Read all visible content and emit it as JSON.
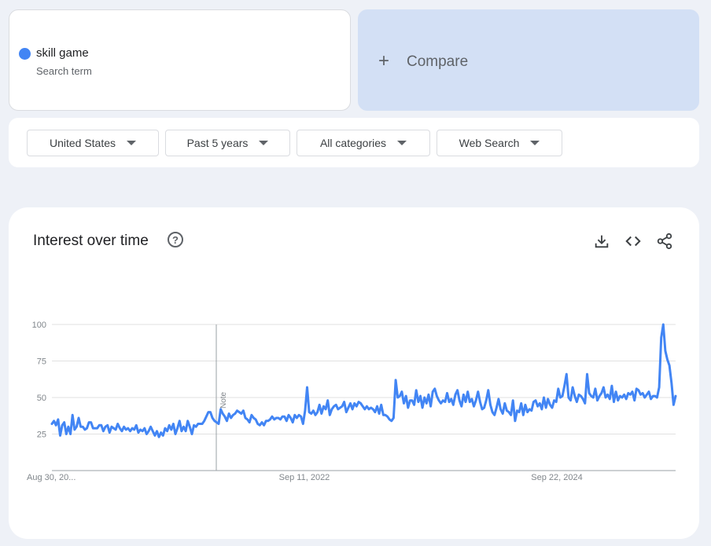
{
  "search_term": {
    "name": "skill game",
    "subtitle": "Search term",
    "color": "#4285f4"
  },
  "compare": {
    "plus": "+",
    "label": "Compare"
  },
  "filters": [
    {
      "label": "United States"
    },
    {
      "label": "Past 5 years"
    },
    {
      "label": "All categories"
    },
    {
      "label": "Web Search"
    }
  ],
  "chart_card": {
    "title": "Interest over time",
    "help_icon": "help-circle-icon",
    "tools": [
      "download-icon",
      "embed-code-icon",
      "share-icon"
    ],
    "help_glyph": "?",
    "embed_glyph": "<>"
  },
  "chart_data": {
    "type": "line",
    "title": "",
    "xlabel": "",
    "ylabel": "",
    "ylim": [
      0,
      100
    ],
    "grid": true,
    "y_ticks": [
      "25",
      "50",
      "75",
      "100"
    ],
    "x_ticks": [
      "Aug 30, 20...",
      "Sep 11, 2022",
      "Sep 22, 2024"
    ],
    "note_label": "Note",
    "series": [
      {
        "color": "#4285f4",
        "values": [
          32,
          34,
          31,
          35,
          24,
          31,
          33,
          25,
          30,
          25,
          38,
          28,
          30,
          36,
          30,
          30,
          28,
          29,
          33,
          33,
          29,
          29,
          29,
          31,
          31,
          27,
          30,
          31,
          26,
          30,
          29,
          28,
          32,
          29,
          27,
          30,
          28,
          29,
          27,
          29,
          28,
          31,
          26,
          28,
          27,
          29,
          25,
          27,
          30,
          27,
          24,
          27,
          23,
          26,
          24,
          29,
          27,
          31,
          28,
          32,
          25,
          29,
          34,
          27,
          30,
          27,
          34,
          30,
          25,
          31,
          30,
          32,
          32,
          32,
          34,
          37,
          40,
          40,
          36,
          34,
          33,
          32,
          42,
          39,
          37,
          34,
          39,
          36,
          38,
          39,
          41,
          40,
          39,
          41,
          36,
          35,
          33,
          38,
          36,
          35,
          32,
          31,
          33,
          31,
          34,
          34,
          35,
          37,
          35,
          36,
          36,
          35,
          37,
          37,
          34,
          38,
          36,
          33,
          38,
          36,
          38,
          37,
          32,
          41,
          57,
          40,
          39,
          41,
          38,
          40,
          45,
          39,
          44,
          42,
          48,
          38,
          42,
          44,
          45,
          42,
          43,
          44,
          47,
          40,
          43,
          46,
          42,
          46,
          44,
          47,
          46,
          44,
          42,
          44,
          42,
          43,
          42,
          40,
          44,
          39,
          45,
          38,
          38,
          37,
          35,
          34,
          36,
          62,
          50,
          51,
          54,
          46,
          51,
          43,
          48,
          48,
          45,
          55,
          47,
          51,
          43,
          50,
          46,
          52,
          44,
          54,
          56,
          51,
          48,
          46,
          48,
          47,
          53,
          47,
          49,
          45,
          52,
          55,
          48,
          44,
          52,
          47,
          54,
          47,
          49,
          44,
          48,
          54,
          47,
          42,
          43,
          48,
          55,
          45,
          40,
          38,
          43,
          49,
          42,
          39,
          46,
          41,
          40,
          38,
          48,
          34,
          41,
          40,
          46,
          38,
          45,
          40,
          42,
          41,
          47,
          48,
          44,
          46,
          42,
          50,
          43,
          49,
          45,
          43,
          48,
          47,
          56,
          50,
          51,
          58,
          66,
          50,
          48,
          57,
          51,
          47,
          52,
          51,
          49,
          46,
          66,
          53,
          51,
          50,
          56,
          48,
          51,
          53,
          57,
          50,
          52,
          49,
          58,
          47,
          54,
          48,
          51,
          50,
          52,
          49,
          53,
          52,
          54,
          48,
          56,
          55,
          52,
          53,
          50,
          52,
          54,
          49,
          51,
          51,
          50,
          57,
          91,
          100,
          82,
          76,
          72,
          60,
          45,
          51
        ]
      }
    ]
  }
}
